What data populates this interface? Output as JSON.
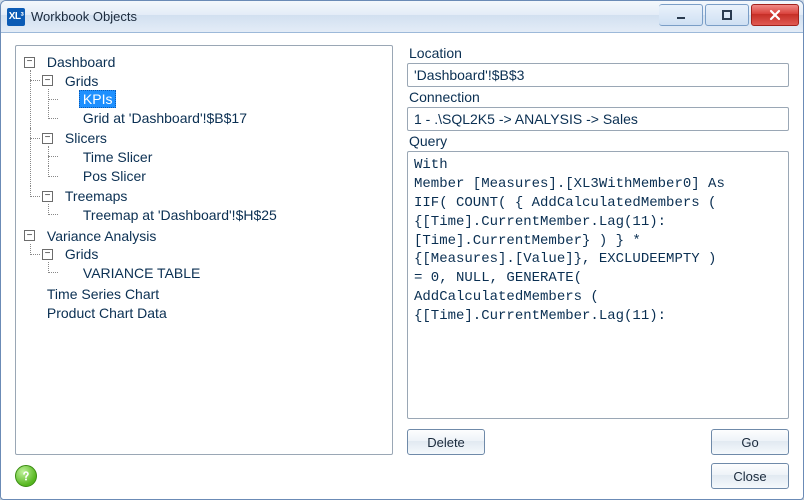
{
  "window": {
    "app_icon_text": "XL³",
    "title": "Workbook Objects"
  },
  "tree": {
    "nodes": [
      {
        "label": "Dashboard",
        "expanded": true,
        "children": [
          {
            "label": "Grids",
            "expanded": true,
            "children": [
              {
                "label": "KPIs",
                "selected": true
              },
              {
                "label": "Grid at 'Dashboard'!$B$17"
              }
            ]
          },
          {
            "label": "Slicers",
            "expanded": true,
            "children": [
              {
                "label": "Time Slicer"
              },
              {
                "label": "Pos Slicer"
              }
            ]
          },
          {
            "label": "Treemaps",
            "expanded": true,
            "children": [
              {
                "label": "Treemap at 'Dashboard'!$H$25"
              }
            ]
          }
        ]
      },
      {
        "label": "Variance Analysis",
        "expanded": true,
        "children": [
          {
            "label": "Grids",
            "expanded": true,
            "children": [
              {
                "label": "VARIANCE TABLE"
              }
            ]
          }
        ]
      },
      {
        "label": "Time Series Chart"
      },
      {
        "label": "Product Chart Data"
      }
    ]
  },
  "details": {
    "location_label": "Location",
    "location_value": "'Dashboard'!$B$3",
    "connection_label": "Connection",
    "connection_value": "1 - .\\SQL2K5 -> ANALYSIS -> Sales",
    "query_label": "Query",
    "query_text": "With\nMember [Measures].[XL3WithMember0] As\nIIF( COUNT( { AddCalculatedMembers (\n{[Time].CurrentMember.Lag(11):\n[Time].CurrentMember} ) } *\n{[Measures].[Value]}, EXCLUDEEMPTY )\n= 0, NULL, GENERATE(\nAddCalculatedMembers (\n{[Time].CurrentMember.Lag(11):"
  },
  "buttons": {
    "delete": "Delete",
    "go": "Go",
    "close": "Close"
  },
  "icons": {
    "minimize": "minimize",
    "maximize": "maximize",
    "close": "close",
    "help": "help"
  }
}
